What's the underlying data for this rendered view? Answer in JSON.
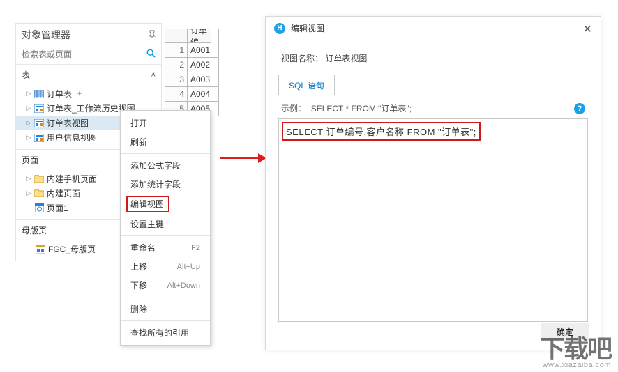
{
  "object_manager": {
    "title": "对象管理器",
    "search_placeholder": "检索表或页面",
    "sections": {
      "tables": {
        "label": "表",
        "items": [
          {
            "label": "订单表"
          },
          {
            "label": "订单表_工作流历史视图"
          },
          {
            "label": "订单表视图",
            "selected": true
          },
          {
            "label": "用户信息视图"
          }
        ]
      },
      "pages": {
        "label": "页面",
        "items": [
          {
            "label": "内建手机页面"
          },
          {
            "label": "内建页面"
          },
          {
            "label": "页面1"
          }
        ]
      },
      "master_pages": {
        "label": "母版页",
        "items": [
          {
            "label": "FGC_母版页"
          }
        ]
      }
    }
  },
  "grid": {
    "header_col2": "订单编",
    "rows": [
      {
        "n": "1",
        "v": "A001"
      },
      {
        "n": "2",
        "v": "A002"
      },
      {
        "n": "3",
        "v": "A003"
      },
      {
        "n": "4",
        "v": "A004"
      },
      {
        "n": "5",
        "v": "A005"
      }
    ]
  },
  "context_menu": {
    "items": [
      {
        "label": "打开"
      },
      {
        "label": "刷新"
      },
      {
        "label": "添加公式字段",
        "sep": true
      },
      {
        "label": "添加统计字段"
      },
      {
        "label": "编辑视图",
        "highlight": true
      },
      {
        "label": "设置主键"
      },
      {
        "label": "重命名",
        "shortcut": "F2",
        "sep": true
      },
      {
        "label": "上移",
        "shortcut": "Alt+Up"
      },
      {
        "label": "下移",
        "shortcut": "Alt+Down"
      },
      {
        "label": "删除",
        "sep": true
      },
      {
        "label": "查找所有的引用",
        "sep": true
      }
    ]
  },
  "dialog": {
    "title": "编辑视图",
    "view_name_label": "视图名称：",
    "view_name_value": "订单表视图",
    "tab_label": "SQL 语句",
    "example_label": "示例：",
    "example_sql": "SELECT * FROM \"订单表\";",
    "sql_text": "SELECT 订单编号,客户名称 FROM \"订单表\";",
    "ok_label": "确定"
  },
  "watermark": {
    "big": "下载吧",
    "small": "www.xiazaiba.com"
  }
}
